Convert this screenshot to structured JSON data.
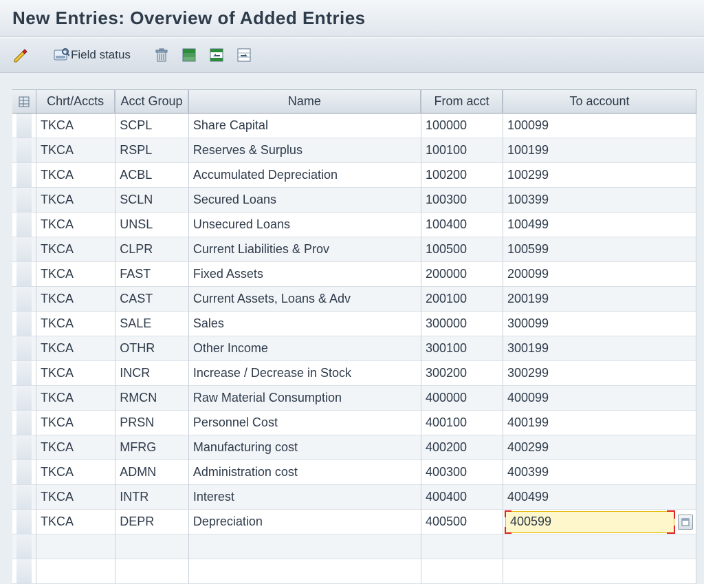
{
  "title": "New Entries: Overview of Added Entries",
  "toolbar": {
    "field_status_label": "Field status"
  },
  "table": {
    "headers": {
      "chrt": "Chrt/Accts",
      "group": "Acct Group",
      "name": "Name",
      "from": "From acct",
      "to": "To account"
    },
    "rows": [
      {
        "chrt": "TKCA",
        "group": "SCPL",
        "name": "Share Capital",
        "from": "100000",
        "to": "100099"
      },
      {
        "chrt": "TKCA",
        "group": "RSPL",
        "name": "Reserves & Surplus",
        "from": "100100",
        "to": "100199"
      },
      {
        "chrt": "TKCA",
        "group": "ACBL",
        "name": "Accumulated Depreciation",
        "from": "100200",
        "to": "100299"
      },
      {
        "chrt": "TKCA",
        "group": "SCLN",
        "name": "Secured Loans",
        "from": "100300",
        "to": "100399"
      },
      {
        "chrt": "TKCA",
        "group": "UNSL",
        "name": "Unsecured Loans",
        "from": "100400",
        "to": "100499"
      },
      {
        "chrt": "TKCA",
        "group": "CLPR",
        "name": "Current Liabilities & Prov",
        "from": "100500",
        "to": "100599"
      },
      {
        "chrt": "TKCA",
        "group": "FAST",
        "name": "Fixed Assets",
        "from": "200000",
        "to": "200099"
      },
      {
        "chrt": "TKCA",
        "group": "CAST",
        "name": "Current Assets, Loans & Adv",
        "from": "200100",
        "to": "200199"
      },
      {
        "chrt": "TKCA",
        "group": "SALE",
        "name": "Sales",
        "from": "300000",
        "to": "300099"
      },
      {
        "chrt": "TKCA",
        "group": "OTHR",
        "name": "Other Income",
        "from": "300100",
        "to": "300199"
      },
      {
        "chrt": "TKCA",
        "group": "INCR",
        "name": "Increase / Decrease in Stock",
        "from": "300200",
        "to": "300299"
      },
      {
        "chrt": "TKCA",
        "group": "RMCN",
        "name": "Raw Material Consumption",
        "from": "400000",
        "to": "400099"
      },
      {
        "chrt": "TKCA",
        "group": "PRSN",
        "name": "Personnel Cost",
        "from": "400100",
        "to": "400199"
      },
      {
        "chrt": "TKCA",
        "group": "MFRG",
        "name": "Manufacturing cost",
        "from": "400200",
        "to": "400299"
      },
      {
        "chrt": "TKCA",
        "group": "ADMN",
        "name": "Administration cost",
        "from": "400300",
        "to": "400399"
      },
      {
        "chrt": "TKCA",
        "group": "INTR",
        "name": "Interest",
        "from": "400400",
        "to": "400499"
      },
      {
        "chrt": "TKCA",
        "group": "DEPR",
        "name": "Depreciation",
        "from": "400500",
        "to": "400599",
        "active_to": true
      }
    ],
    "empty_rows": 2
  }
}
